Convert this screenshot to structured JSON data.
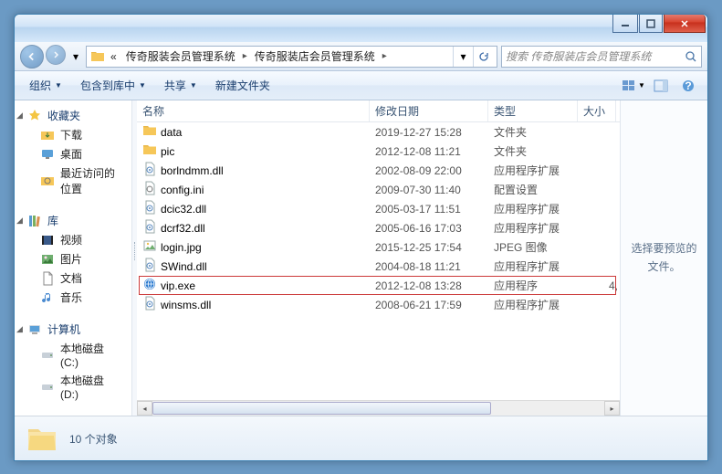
{
  "breadcrumb": {
    "sep": "«",
    "part1": "传奇服装会员管理系统",
    "part2": "传奇服装店会员管理系统",
    "arrow": "▸"
  },
  "search": {
    "placeholder": "搜索 传奇服装店会员管理系统"
  },
  "toolbar": {
    "organize": "组织",
    "include": "包含到库中",
    "share": "共享",
    "newfolder": "新建文件夹"
  },
  "nav": {
    "fav": "收藏夹",
    "fav_items": [
      "下载",
      "桌面",
      "最近访问的位置"
    ],
    "lib": "库",
    "lib_items": [
      "视频",
      "图片",
      "文档",
      "音乐"
    ],
    "comp": "计算机",
    "comp_items": [
      "本地磁盘 (C:)",
      "本地磁盘 (D:)"
    ]
  },
  "cols": {
    "name": "名称",
    "date": "修改日期",
    "type": "类型",
    "size": "大小"
  },
  "files": [
    {
      "icon": "folder",
      "name": "data",
      "date": "2019-12-27 15:28",
      "type": "文件夹",
      "size": ""
    },
    {
      "icon": "folder",
      "name": "pic",
      "date": "2012-12-08 11:21",
      "type": "文件夹",
      "size": ""
    },
    {
      "icon": "dll",
      "name": "borlndmm.dll",
      "date": "2002-08-09 22:00",
      "type": "应用程序扩展",
      "size": ""
    },
    {
      "icon": "ini",
      "name": "config.ini",
      "date": "2009-07-30 11:40",
      "type": "配置设置",
      "size": ""
    },
    {
      "icon": "dll",
      "name": "dcic32.dll",
      "date": "2005-03-17 11:51",
      "type": "应用程序扩展",
      "size": ""
    },
    {
      "icon": "dll",
      "name": "dcrf32.dll",
      "date": "2005-06-16 17:03",
      "type": "应用程序扩展",
      "size": ""
    },
    {
      "icon": "jpg",
      "name": "login.jpg",
      "date": "2015-12-25 17:54",
      "type": "JPEG 图像",
      "size": ""
    },
    {
      "icon": "dll",
      "name": "SWind.dll",
      "date": "2004-08-18 11:21",
      "type": "应用程序扩展",
      "size": ""
    },
    {
      "icon": "exe",
      "name": "vip.exe",
      "date": "2012-12-08 13:28",
      "type": "应用程序",
      "size": "4,",
      "selected": true
    },
    {
      "icon": "dll",
      "name": "winsms.dll",
      "date": "2008-06-21 17:59",
      "type": "应用程序扩展",
      "size": ""
    }
  ],
  "preview": "选择要预览的文件。",
  "status": "10 个对象"
}
